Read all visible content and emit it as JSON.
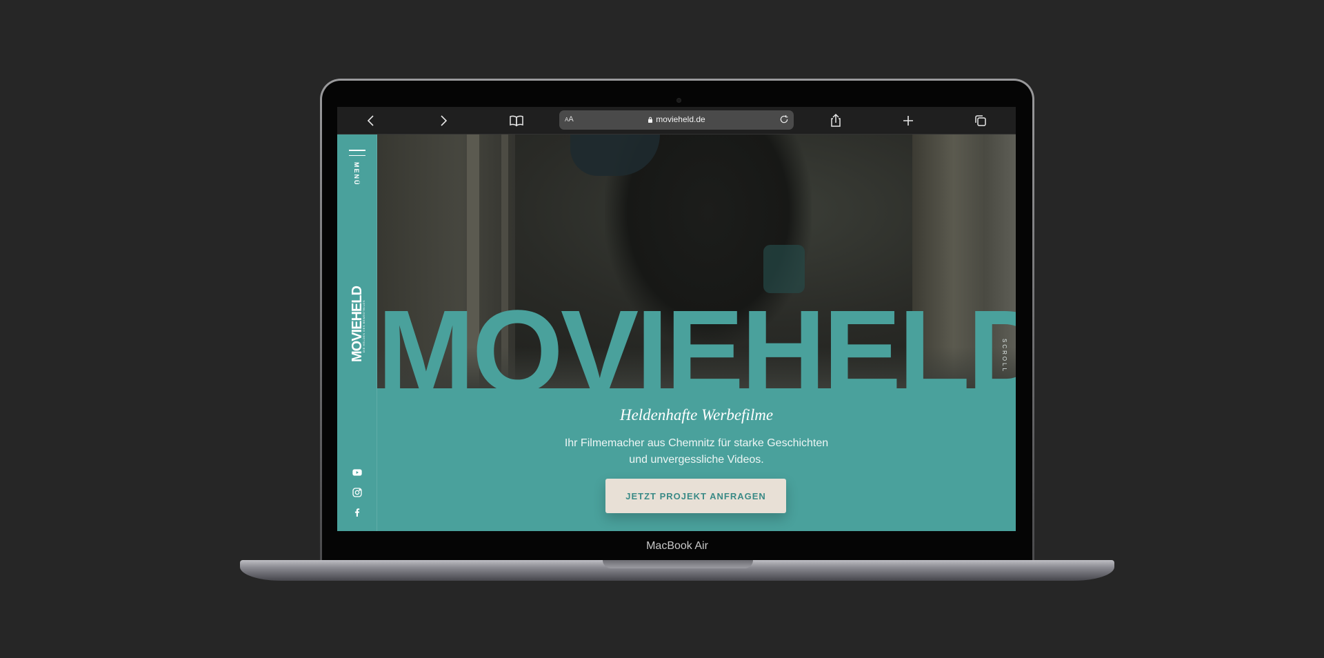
{
  "browser": {
    "url": "movieheld.de",
    "reader_label": "AA",
    "icons": [
      "back-icon",
      "forward-icon",
      "bookmarks-icon",
      "lock-icon",
      "reload-icon",
      "share-icon",
      "new-tab-icon",
      "tabs-icon"
    ]
  },
  "sidebar": {
    "menu_label": "MENÜ",
    "logo_text": "MOVIEHELD",
    "logo_subtitle": "DIE HELDEN DES BEWEGTBILDS",
    "socials": [
      "youtube-icon",
      "instagram-icon",
      "facebook-icon"
    ]
  },
  "hero": {
    "title": "MOVIEHELD",
    "scroll_label": "SCROLL"
  },
  "content": {
    "tagline": "Heldenhafte Werbefilme",
    "description_line1": "Ihr Filmemacher aus Chemnitz für starke Geschichten",
    "description_line2": "und unvergessliche Videos.",
    "cta_label": "JETZT PROJEKT ANFRAGEN"
  },
  "device": {
    "label": "MacBook Air"
  },
  "colors": {
    "accent": "#4aa19c",
    "button_bg": "#e8e0d6",
    "button_text": "#3a8a86",
    "background": "#262626"
  }
}
